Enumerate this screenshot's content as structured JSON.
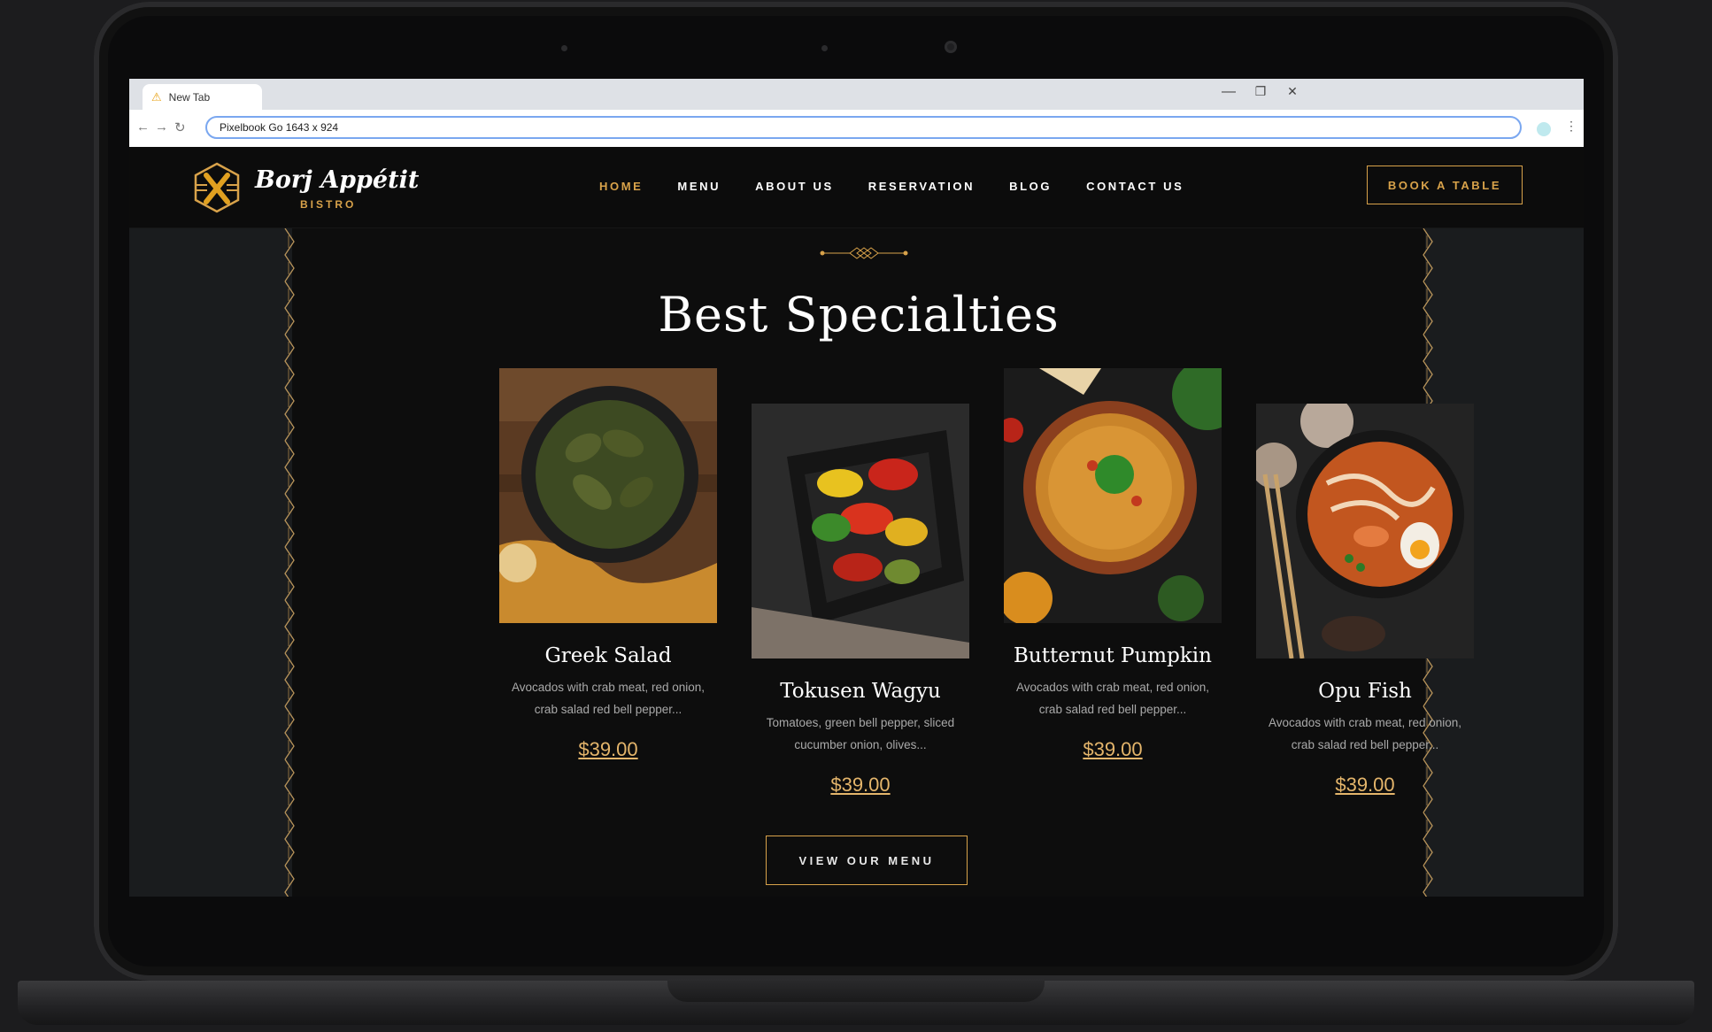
{
  "browser": {
    "tab_title": "New Tab",
    "address": "Pixelbook Go  1643 x 924",
    "controls": {
      "minimize": "—",
      "restore": "❐",
      "close": "✕"
    }
  },
  "site": {
    "logo": {
      "name": "Borj Appétit",
      "subtitle": "BISTRO",
      "brand_color": "#d8a24a"
    },
    "nav": [
      {
        "label": "HOME",
        "active": true
      },
      {
        "label": "MENU",
        "active": false
      },
      {
        "label": "ABOUT US",
        "active": false
      },
      {
        "label": "RESERVATION",
        "active": false
      },
      {
        "label": "BLOG",
        "active": false
      },
      {
        "label": "CONTACT US",
        "active": false
      }
    ],
    "book_button": "BOOK A TABLE"
  },
  "section": {
    "title": "Best Specialties",
    "cards": [
      {
        "title": "Greek Salad",
        "description": "Avocados with crab meat, red onion, crab salad red bell pepper...",
        "price": "$39.00",
        "image": "herb-chicken-skillet"
      },
      {
        "title": "Tokusen Wagyu",
        "description": "Tomatoes, green bell pepper, sliced cucumber onion, olives...",
        "price": "$39.00",
        "image": "grilled-vegetables-pan"
      },
      {
        "title": "Butternut Pumpkin",
        "description": "Avocados with crab meat, red onion, crab salad red bell pepper...",
        "price": "$39.00",
        "image": "lentil-soup-bowl"
      },
      {
        "title": "Opu Fish",
        "description": "Avocados with crab meat, red onion, crab salad red bell pepper...",
        "price": "$39.00",
        "image": "seafood-noodle-bowl"
      }
    ],
    "cta": "VIEW OUR MENU"
  }
}
